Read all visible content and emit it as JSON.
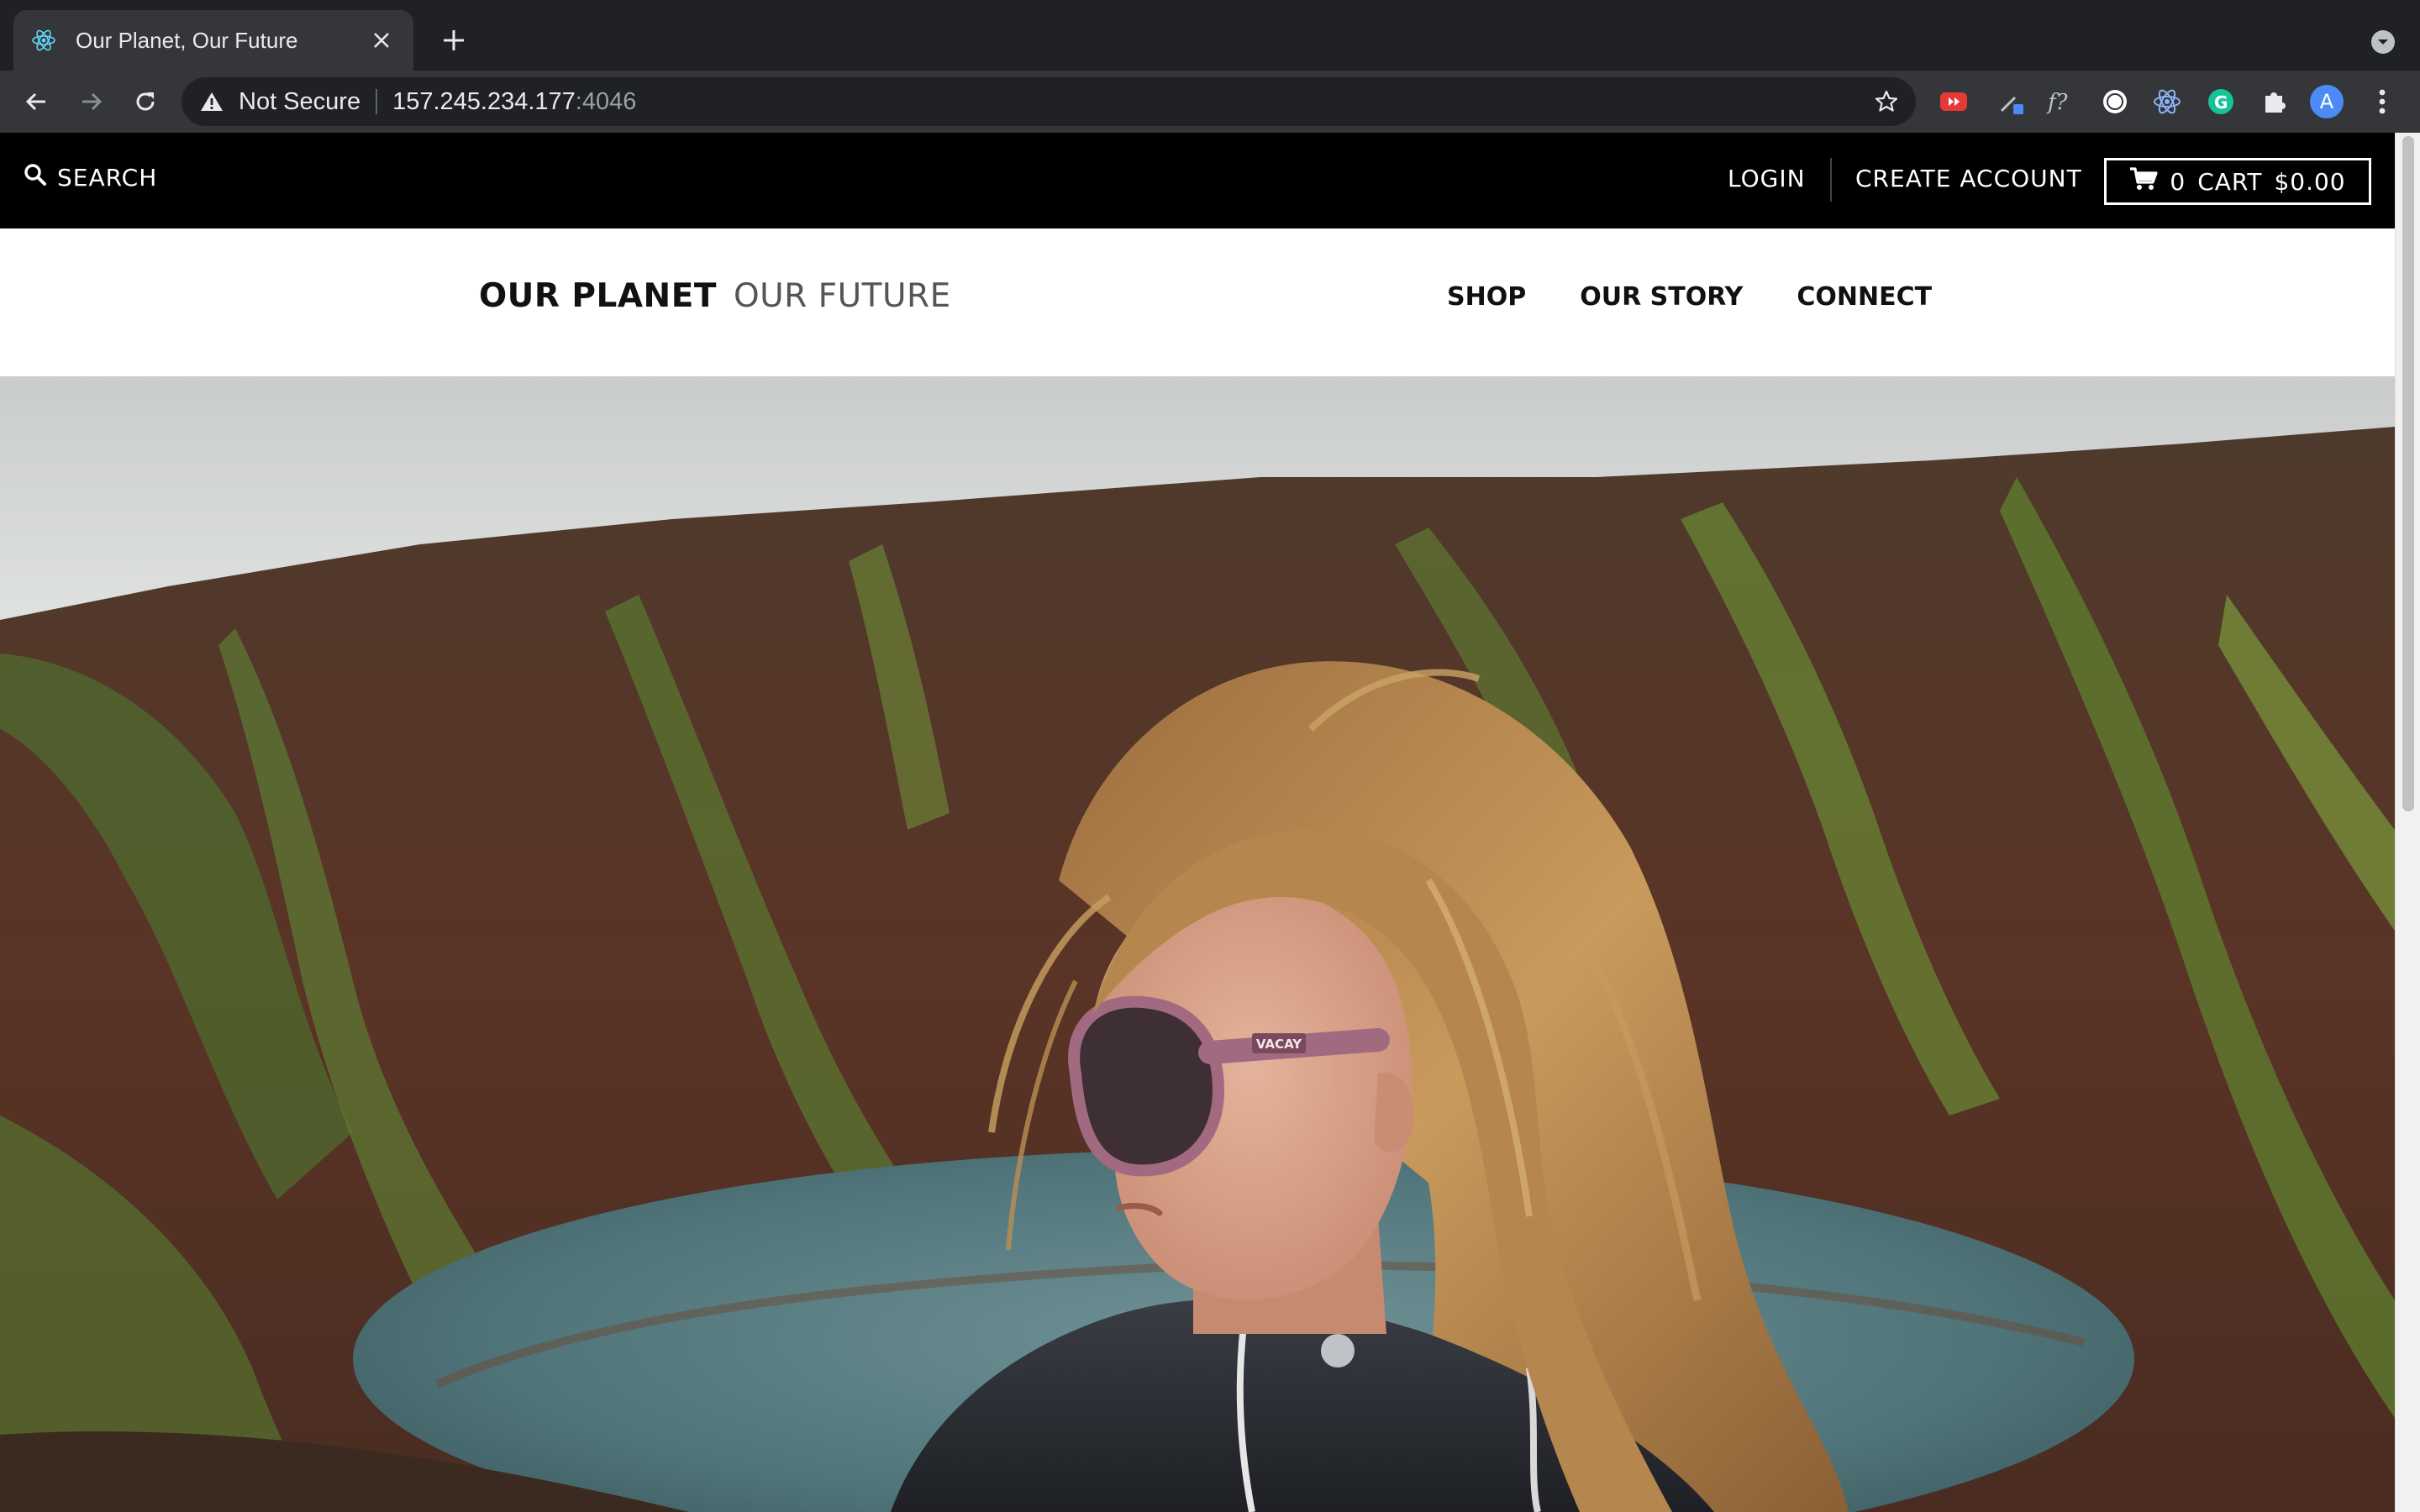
{
  "browser": {
    "tab_title": "Our Planet, Our Future",
    "security_label": "Not Secure",
    "url_host": "157.245.234.177",
    "url_port": ":4046",
    "profile_initial": "A"
  },
  "site": {
    "topbar": {
      "search_label": "SEARCH",
      "login_label": "LOGIN",
      "create_account_label": "CREATE ACCOUNT",
      "cart_count": "0",
      "cart_label": "CART",
      "cart_total": "$0.00"
    },
    "brand": {
      "primary": "OUR PLANET",
      "secondary": "OUR FUTURE"
    },
    "nav": [
      {
        "label": "SHOP"
      },
      {
        "label": "OUR STORY"
      },
      {
        "label": "CONNECT"
      }
    ],
    "hero": {
      "sunglasses_logo": "VACAY"
    }
  },
  "colors": {
    "chrome_dark": "#202124",
    "chrome_toolbar": "#35363a",
    "topbar": "#000000",
    "accent_blue": "#4c8bf5"
  }
}
